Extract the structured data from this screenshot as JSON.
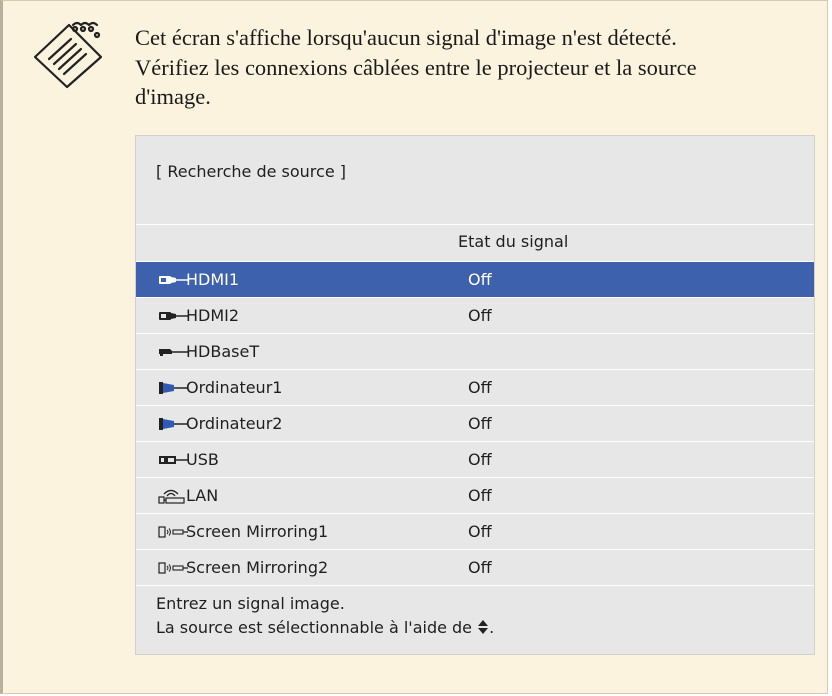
{
  "note": {
    "icon": "note-pencil-icon",
    "text_lines": [
      "Cet écran s'affiche lorsqu'aucun signal d'image n'est détecté.",
      "Vérifiez les connexions câblées entre le projecteur et la source",
      "d'image."
    ]
  },
  "panel": {
    "title": "[ Recherche de source ]",
    "signal_column_header": "Etat du signal",
    "selected_color": "#3e61ad",
    "sources": [
      {
        "name": "HDMI1",
        "state": "Off",
        "icon": "hdmi-icon",
        "selected": true
      },
      {
        "name": "HDMI2",
        "state": "Off",
        "icon": "hdmi-icon",
        "selected": false
      },
      {
        "name": "HDBaseT",
        "state": "",
        "icon": "hdbaset-icon",
        "selected": false
      },
      {
        "name": "Ordinateur1",
        "state": "Off",
        "icon": "computer-vga-icon",
        "selected": false
      },
      {
        "name": "Ordinateur2",
        "state": "Off",
        "icon": "computer-vga-icon",
        "selected": false
      },
      {
        "name": "USB",
        "state": "Off",
        "icon": "usb-icon",
        "selected": false
      },
      {
        "name": "LAN",
        "state": "Off",
        "icon": "lan-icon",
        "selected": false
      },
      {
        "name": "Screen Mirroring1",
        "state": "Off",
        "icon": "screen-mirroring-icon",
        "selected": false
      },
      {
        "name": "Screen Mirroring2",
        "state": "Off",
        "icon": "screen-mirroring-icon",
        "selected": false
      }
    ],
    "footer_line1": "Entrez un signal image.",
    "footer_line2": "La source est sélectionnable à l'aide de",
    "footer_line2_end": "."
  }
}
